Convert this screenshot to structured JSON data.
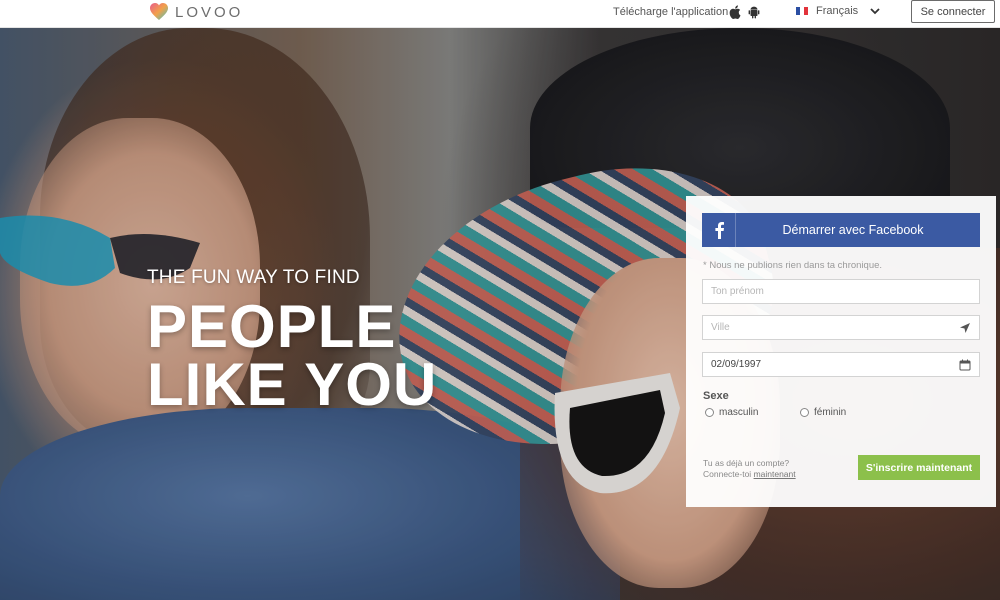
{
  "header": {
    "brand": "LOVOO",
    "app_label": "Télécharge l'application",
    "language": "Français",
    "login_label": "Se connecter"
  },
  "hero": {
    "tagline": "THE FUN WAY TO FIND",
    "headline_line1": "PEOPLE",
    "headline_line2": "LIKE YOU"
  },
  "form": {
    "facebook_label": "Démarrer avec Facebook",
    "notice": "* Nous ne publions rien dans ta chronique.",
    "name_placeholder": "Ton prénom",
    "city_placeholder": "Ville",
    "birthdate_value": "02/09/1997",
    "sex_label": "Sexe",
    "sex_options": [
      "masculin",
      "féminin"
    ],
    "login_hint_line1": "Tu as déjà un compte?",
    "login_hint_prefix": "Connecte-toi ",
    "login_hint_link": "maintenant",
    "signup_label": "S'inscrire maintenant"
  },
  "colors": {
    "facebook_blue": "#3b5aa3",
    "signup_green": "#8cc04b",
    "logo_pink": "#e85c8c",
    "logo_teal": "#3cc4c4"
  },
  "icons": [
    "heart-logo-icon",
    "apple-icon",
    "android-icon",
    "france-flag-icon",
    "chevron-down-icon",
    "facebook-icon",
    "location-arrow-icon",
    "calendar-icon"
  ]
}
